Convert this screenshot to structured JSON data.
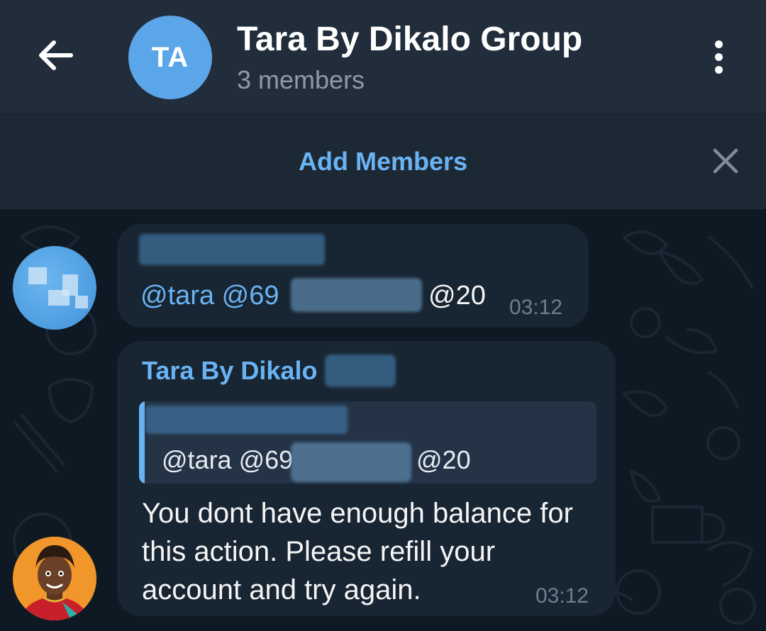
{
  "header": {
    "avatar_initials": "TA",
    "title": "Tara By Dikalo Group",
    "subtitle": "3 members"
  },
  "banner": {
    "add_members_label": "Add Members"
  },
  "messages": [
    {
      "text_visible": "@tara @69",
      "text_tail": "@20",
      "time": "03:12"
    },
    {
      "sender": "Tara By Dikalo",
      "reply_text_visible": "@tara @69",
      "reply_text_tail": "@20",
      "body": "You dont have enough balance for this action. Please refill your account and try again.",
      "time": "03:12"
    }
  ],
  "colors": {
    "header_bg": "#212d3b",
    "chat_bg": "#0f1923",
    "bubble_bg": "#182533",
    "accent": "#6ab3f3",
    "avatar_blue": "#5ba6e8"
  },
  "icons": {
    "back": "arrow-left-icon",
    "menu": "more-vertical-icon",
    "close": "close-icon"
  }
}
